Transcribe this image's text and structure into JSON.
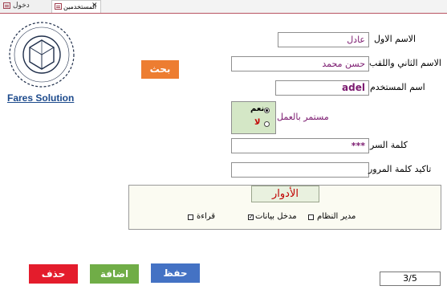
{
  "tabs": {
    "form_tab": "دخول",
    "active_tab": "المستخدمين",
    "close": "✕"
  },
  "logo": {
    "link_text": "Fares Solution",
    "ring_text": "FARES SOLUTION"
  },
  "form": {
    "first_name_label": "الاسم الاول",
    "first_name_value": "عادل",
    "second_name_label": "الاسم الثاني واللقب",
    "second_name_value": "حسن محمد",
    "username_label": "اسم المستخدم",
    "username_value": "adel",
    "employed_label": "مستمر بالعمل",
    "employed_yes": "نعم",
    "employed_no": "لا",
    "employed_selected": "yes",
    "password_label": "كلمة السر",
    "password_value": "***",
    "confirm_label": "تاكيد كلمة المرور",
    "confirm_value": ""
  },
  "search_button": "بحث",
  "roles": {
    "title": "الأدوار",
    "items": [
      {
        "label": "مدير النظام",
        "checked": false
      },
      {
        "label": "مدخل بيانات",
        "checked": true
      },
      {
        "label": "قراءة",
        "checked": false
      }
    ]
  },
  "actions": {
    "save": "حفظ",
    "add": "اضافة",
    "delete": "حذف"
  },
  "record_counter": "3/5",
  "colors": {
    "save": "#4472c4",
    "add": "#70ad47",
    "delete": "#e41c2c",
    "search": "#ed7d31",
    "field_text": "#7b1a6f",
    "roles_title": "#c00000"
  }
}
